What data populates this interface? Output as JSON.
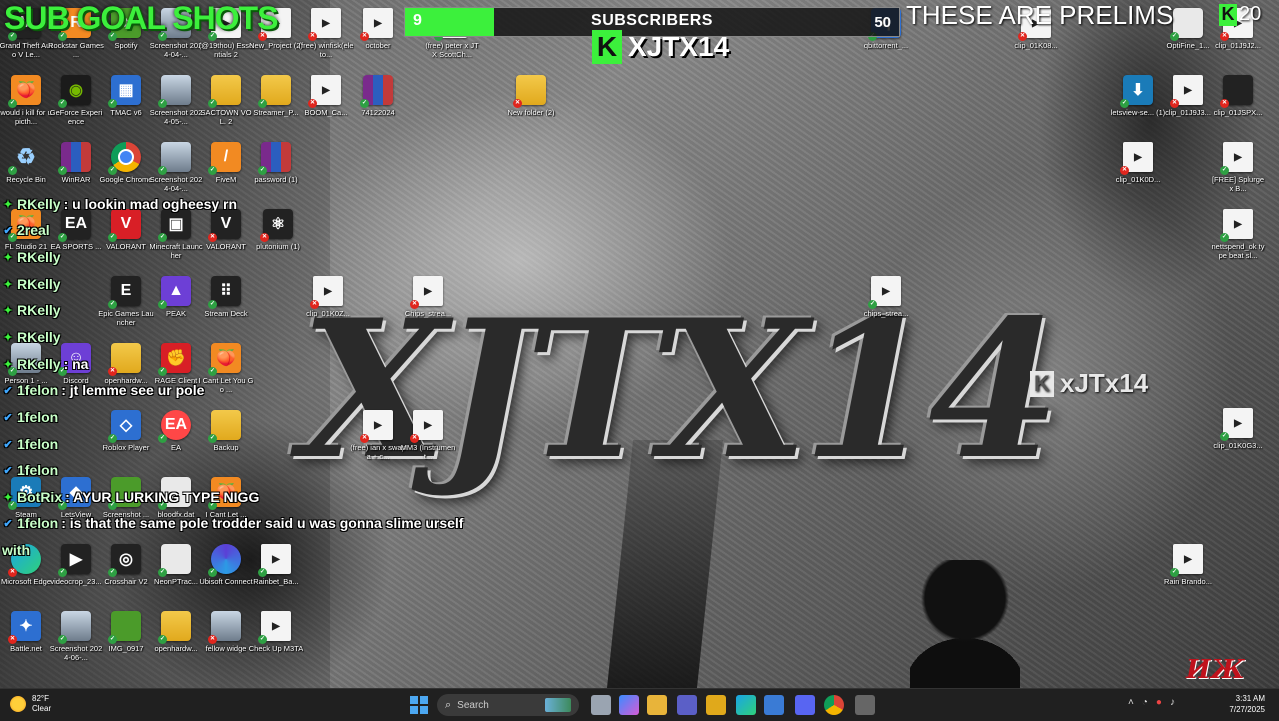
{
  "overlay": {
    "sub_goal_title": "SUB GOAL SHOTS",
    "subscribers_label": "SUBSCRIBERS",
    "subscribers_current": "9",
    "subscribers_goal": "50",
    "subscribers_progress": 0.18,
    "channel_name": "XJTX14",
    "channel_logo_letter": "K",
    "top_right_text": "THESE ARE PRELIMS",
    "corner_count": "20",
    "accent_color": "#3cf03c"
  },
  "wallpaper": {
    "title": "XJTX14",
    "brand": "xJTx14",
    "brand_letter": "K",
    "stream_logo": "ИЖ"
  },
  "chat": [
    {
      "badge": "sub",
      "user": "RKelly",
      "message": ": u lookin mad ogheesy rn"
    },
    {
      "badge": "verified",
      "user": "2real",
      "message": ""
    },
    {
      "badge": "sub",
      "user": "RKelly",
      "message": ""
    },
    {
      "badge": "sub",
      "user": "RKelly",
      "message": ""
    },
    {
      "badge": "sub",
      "user": "RKelly",
      "message": ""
    },
    {
      "badge": "sub",
      "user": "RKelly",
      "message": ""
    },
    {
      "badge": "sub",
      "user": "RKelly",
      "message": ": na"
    },
    {
      "badge": "verified",
      "user": "1felon",
      "message": ": jt lemme see ur pole"
    },
    {
      "badge": "verified",
      "user": "1felon",
      "message": ""
    },
    {
      "badge": "verified",
      "user": "1felon",
      "message": ""
    },
    {
      "badge": "verified",
      "user": "1felon",
      "message": ""
    },
    {
      "badge": "sub",
      "user": "BotRix",
      "message": ": AYUR LURKING TYPE NIGG"
    },
    {
      "badge": "verified",
      "user": "1felon",
      "message": ": is that the same pole trodder said u was gonna slime urself"
    },
    {
      "badge": "none",
      "user": "with",
      "message": ""
    }
  ],
  "desktop_icons": [
    {
      "label": "Grand Theft Auto V Le...",
      "icon": "gta-icon",
      "style": "g-dark",
      "glyph": "V"
    },
    {
      "label": "Rockstar Games ...",
      "icon": "rockstar-icon",
      "style": "g-orange",
      "glyph": "R"
    },
    {
      "label": "Spotify",
      "icon": "spotify-icon",
      "style": "g-green",
      "glyph": "♪"
    },
    {
      "label": "Screenshot 2024-04-...",
      "icon": "image-icon",
      "style": "g-photo",
      "glyph": ""
    },
    {
      "label": "(@19thou) Essentials 2",
      "icon": "video-file-icon",
      "style": "g-file",
      "glyph": ""
    },
    {
      "label": "New_Project (2)",
      "icon": "video-file-icon",
      "style": "g-file",
      "glyph": ""
    },
    {
      "label": "(free) winfisk(eleto...",
      "icon": "video-file-icon",
      "style": "g-file",
      "glyph": ""
    },
    {
      "label": "october",
      "icon": "video-file-icon",
      "style": "g-file",
      "glyph": ""
    },
    {
      "label": "(free) peter x JTX ScottCh...",
      "icon": "video-file-icon",
      "style": "g-file",
      "glyph": ""
    },
    {
      "label": "qbittorrent_...",
      "icon": "torrent-icon",
      "style": "g-blue",
      "glyph": "q"
    },
    {
      "label": "clip_01K08...",
      "icon": "video-file-icon",
      "style": "g-file",
      "glyph": ""
    },
    {
      "label": "OptiFine_1...",
      "icon": "file-icon",
      "style": "g-white",
      "glyph": ""
    },
    {
      "label": "clip_01J9J2...",
      "icon": "video-file-icon",
      "style": "g-file",
      "glyph": ""
    },
    {
      "label": "would i kill for u picth...",
      "icon": "fl-studio-icon",
      "style": "g-orange",
      "glyph": "🍑"
    },
    {
      "label": "GeForce Experience",
      "icon": "nvidia-icon",
      "style": "g-nvidia",
      "glyph": "◉"
    },
    {
      "label": "TMAC v6",
      "icon": "tmac-icon",
      "style": "g-blue",
      "glyph": "▦"
    },
    {
      "label": "Screenshot 2024-05-...",
      "icon": "image-icon",
      "style": "g-photo",
      "glyph": ""
    },
    {
      "label": "SACTOWN VOL. 2",
      "icon": "folder-icon",
      "style": "g-folder",
      "glyph": ""
    },
    {
      "label": "Streamer_P...",
      "icon": "folder-icon",
      "style": "g-folder",
      "glyph": ""
    },
    {
      "label": "BOOM_Ca...",
      "icon": "video-file-icon",
      "style": "g-file",
      "glyph": ""
    },
    {
      "label": "74122024",
      "icon": "winrar-icon",
      "style": "g-rar",
      "glyph": ""
    },
    {
      "label": "New folder (2)",
      "icon": "folder-icon",
      "style": "g-folder",
      "glyph": ""
    },
    {
      "label": "letsview-se... (1)",
      "icon": "installer-icon",
      "style": "g-teal",
      "glyph": "⬇"
    },
    {
      "label": "clip_01J9J3...",
      "icon": "video-file-icon",
      "style": "g-file",
      "glyph": ""
    },
    {
      "label": "clip_01JSPX...",
      "icon": "video-file-icon",
      "style": "g-dark",
      "glyph": ""
    },
    {
      "label": "Recycle Bin",
      "icon": "recycle-bin-icon",
      "style": "g-recycle",
      "glyph": "♻"
    },
    {
      "label": "WinRAR",
      "icon": "winrar-icon",
      "style": "g-rar",
      "glyph": ""
    },
    {
      "label": "Google Chrome",
      "icon": "chrome-icon",
      "style": "g-chrome",
      "glyph": ""
    },
    {
      "label": "Screenshot 2024-04-...",
      "icon": "image-icon",
      "style": "g-photo",
      "glyph": ""
    },
    {
      "label": "FiveM",
      "icon": "fivem-icon",
      "style": "g-orange",
      "glyph": "/"
    },
    {
      "label": "password (1)",
      "icon": "winrar-icon",
      "style": "g-rar",
      "glyph": ""
    },
    {
      "label": "clip_01K0D...",
      "icon": "video-file-icon",
      "style": "g-file",
      "glyph": ""
    },
    {
      "label": "[FREE] Splurge x B...",
      "icon": "video-file-icon",
      "style": "g-file",
      "glyph": ""
    },
    {
      "label": "FL Studio 21",
      "icon": "fl-studio-icon",
      "style": "g-orange",
      "glyph": "🍑"
    },
    {
      "label": "EA SPORTS ...",
      "icon": "ea-sports-icon",
      "style": "g-dark",
      "glyph": "EA"
    },
    {
      "label": "VALORANT",
      "icon": "valorant-icon",
      "style": "g-red",
      "glyph": "V"
    },
    {
      "label": "Minecraft Launcher",
      "icon": "minecraft-icon",
      "style": "g-dark",
      "glyph": "▣"
    },
    {
      "label": "VALORANT",
      "icon": "valorant-icon",
      "style": "g-dark",
      "glyph": "V"
    },
    {
      "label": "plutonium (1)",
      "icon": "plutonium-icon",
      "style": "g-dark",
      "glyph": "⚛"
    },
    {
      "label": "nettspend_ok type beat sl...",
      "icon": "video-file-icon",
      "style": "g-file",
      "glyph": ""
    },
    {
      "label": "Epic Games Launcher",
      "icon": "epic-games-icon",
      "style": "g-dark",
      "glyph": "E"
    },
    {
      "label": "PEAK",
      "icon": "peak-icon",
      "style": "g-purple",
      "glyph": "▲"
    },
    {
      "label": "Stream Deck",
      "icon": "stream-deck-icon",
      "style": "g-dark",
      "glyph": "⠿"
    },
    {
      "label": "clip_01K0Z...",
      "icon": "video-file-icon",
      "style": "g-file",
      "glyph": ""
    },
    {
      "label": "Chips_strea...",
      "icon": "video-file-icon",
      "style": "g-file",
      "glyph": ""
    },
    {
      "label": "chips_strea...",
      "icon": "video-file-icon",
      "style": "g-file",
      "glyph": ""
    },
    {
      "label": "Person 1 - ...",
      "icon": "image-icon",
      "style": "g-photo",
      "glyph": ""
    },
    {
      "label": "Discord",
      "icon": "discord-icon",
      "style": "g-purple",
      "glyph": "☺"
    },
    {
      "label": "openhardw...",
      "icon": "folder-icon",
      "style": "g-folder",
      "glyph": ""
    },
    {
      "label": "RAGE Client",
      "icon": "rage-icon",
      "style": "g-red",
      "glyph": "✊"
    },
    {
      "label": "I Cant Let You Go ...",
      "icon": "fl-studio-icon",
      "style": "g-orange",
      "glyph": "🍑"
    },
    {
      "label": "clip_01K0G3...",
      "icon": "video-file-icon",
      "style": "g-file",
      "glyph": ""
    },
    {
      "label": "Roblox Player",
      "icon": "roblox-icon",
      "style": "g-blue",
      "glyph": "◇"
    },
    {
      "label": "EA",
      "icon": "ea-icon",
      "style": "g-ea",
      "glyph": "EA"
    },
    {
      "label": "Backup",
      "icon": "folder-icon",
      "style": "g-folder",
      "glyph": ""
    },
    {
      "label": "(free) ian x swapa + c...",
      "icon": "video-file-icon",
      "style": "g-file",
      "glyph": ""
    },
    {
      "label": "MM3 (Instrument...",
      "icon": "video-file-icon",
      "style": "g-file",
      "glyph": ""
    },
    {
      "label": "Steam",
      "icon": "steam-icon",
      "style": "g-teal",
      "glyph": "⚙"
    },
    {
      "label": "LetsView",
      "icon": "letsview-icon",
      "style": "g-blue",
      "glyph": "◆"
    },
    {
      "label": "Screenshot ...",
      "icon": "image-icon",
      "style": "g-green",
      "glyph": ""
    },
    {
      "label": "bloodfx.dat",
      "icon": "file-icon",
      "style": "g-white",
      "glyph": ""
    },
    {
      "label": "I Cant Let ...",
      "icon": "fl-studio-icon",
      "style": "g-orange",
      "glyph": "🍑"
    },
    {
      "label": "Rain Brando...",
      "icon": "video-file-icon",
      "style": "g-file",
      "glyph": ""
    },
    {
      "label": "Microsoft Edge",
      "icon": "edge-icon",
      "style": "g-edge",
      "glyph": ""
    },
    {
      "label": "videocrop_23...",
      "icon": "video-icon",
      "style": "g-dark",
      "glyph": "▶"
    },
    {
      "label": "Crosshair V2",
      "icon": "crosshair-icon",
      "style": "g-dark",
      "glyph": "◎"
    },
    {
      "label": "NeonPTrac...",
      "icon": "file-icon",
      "style": "g-white",
      "glyph": ""
    },
    {
      "label": "Ubisoft Connect",
      "icon": "ubisoft-icon",
      "style": "g-ubi",
      "glyph": ""
    },
    {
      "label": "Rainbet_Ba...",
      "icon": "video-file-icon",
      "style": "g-file",
      "glyph": ""
    },
    {
      "label": "Battle.net",
      "icon": "battlenet-icon",
      "style": "g-blue",
      "glyph": "✦"
    },
    {
      "label": "Screenshot 2024-06-...",
      "icon": "image-icon",
      "style": "g-photo",
      "glyph": ""
    },
    {
      "label": "IMG_0917",
      "icon": "image-icon",
      "style": "g-green",
      "glyph": ""
    },
    {
      "label": "openhardw...",
      "icon": "folder-icon",
      "style": "g-folder",
      "glyph": ""
    },
    {
      "label": "fellow widge",
      "icon": "image-icon",
      "style": "g-photo",
      "glyph": ""
    },
    {
      "label": "Check Up M3TA",
      "icon": "video-file-icon",
      "style": "g-file",
      "glyph": ""
    }
  ],
  "taskbar": {
    "weather_temp": "82°F",
    "weather_desc": "Clear",
    "search_placeholder": "Search",
    "time": "3:31 AM",
    "date": "7/27/2025",
    "apps": [
      "file-explorer-icon",
      "copilot-icon",
      "folder-icon",
      "teams-icon",
      "app-r-icon",
      "edge-icon",
      "store-icon",
      "discord-icon",
      "chrome-icon",
      "widget-icon"
    ]
  }
}
